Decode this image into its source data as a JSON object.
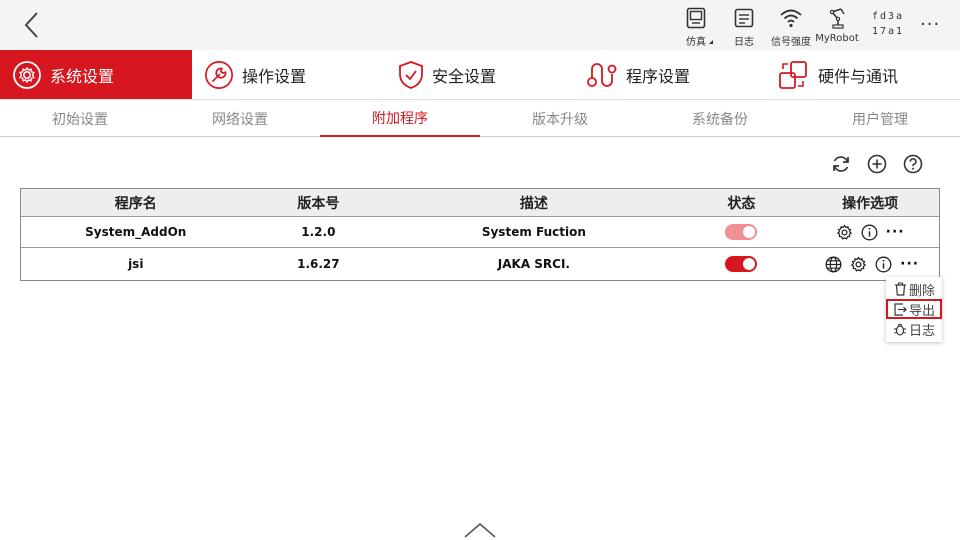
{
  "topbar": {
    "status_items": [
      {
        "label": "仿真",
        "icon": "simulation-icon"
      },
      {
        "label": "日志",
        "icon": "log-icon"
      },
      {
        "label": "信号强度",
        "icon": "wifi-icon"
      },
      {
        "label": "MyRobot",
        "icon": "robot-arm-icon"
      }
    ],
    "serial_line1": "fd3a",
    "serial_line2": "17a1",
    "more": "···"
  },
  "main_tabs": [
    {
      "label": "系统设置",
      "icon": "gear-circle-icon",
      "active": true
    },
    {
      "label": "操作设置",
      "icon": "wrench-icon",
      "active": false
    },
    {
      "label": "安全设置",
      "icon": "shield-check-icon",
      "active": false
    },
    {
      "label": "程序设置",
      "icon": "program-icon",
      "active": false
    },
    {
      "label": "硬件与通讯",
      "icon": "hardware-icon",
      "active": false
    }
  ],
  "sub_tabs": [
    {
      "label": "初始设置",
      "active": false
    },
    {
      "label": "网络设置",
      "active": false
    },
    {
      "label": "附加程序",
      "active": true
    },
    {
      "label": "版本升级",
      "active": false
    },
    {
      "label": "系统备份",
      "active": false
    },
    {
      "label": "用户管理",
      "active": false
    }
  ],
  "toolbar": {
    "icons": [
      "refresh-icon",
      "add-circle-icon",
      "help-circle-icon"
    ]
  },
  "table": {
    "headers": [
      "程序名",
      "版本号",
      "描述",
      "状态",
      "操作选项"
    ],
    "rows": [
      {
        "name": "System_AddOn",
        "version": "1.2.0",
        "description": "System Fuction",
        "enabled_muted": true
      },
      {
        "name": "jsi",
        "version": "1.6.27",
        "description": "JAKA SRCI.",
        "enabled_muted": false
      }
    ],
    "ellipsis": "···"
  },
  "popup_menu": {
    "items": [
      {
        "label": "删除",
        "icon": "trash-icon"
      },
      {
        "label": "导出",
        "icon": "export-icon",
        "selected": true
      },
      {
        "label": "日志",
        "icon": "bug-icon"
      }
    ]
  },
  "colors": {
    "accent": "#d7171f",
    "toggle_muted": "#ee9096",
    "toggle_on": "#d7171f"
  }
}
